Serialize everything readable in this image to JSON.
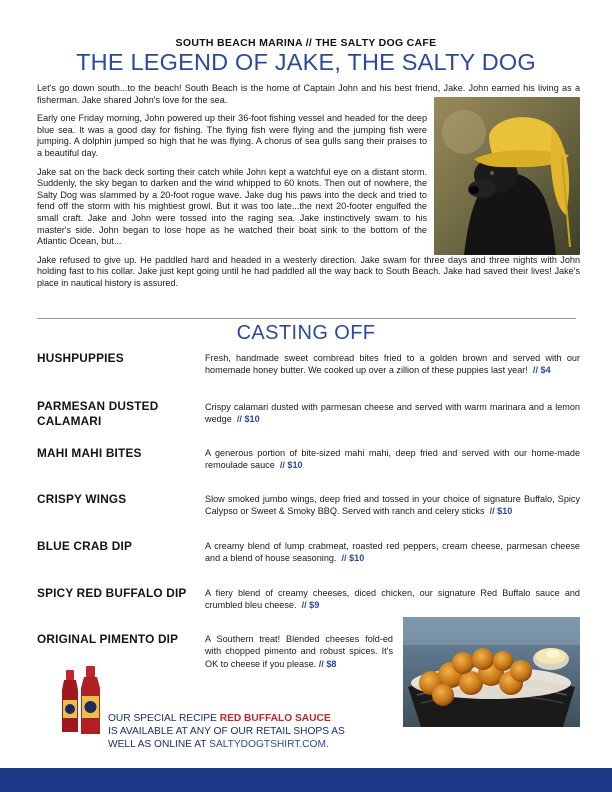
{
  "header": {
    "kicker": "SOUTH BEACH MARINA // THE SALTY DOG CAFE",
    "title": "THE LEGEND OF JAKE, THE SALTY DOG"
  },
  "story": {
    "p1": "Let's go down south...to the beach! South Beach is the home of Captain John and his best friend, Jake. John earned his living as a fisherman. Jake shared John's love for the sea.",
    "p2": "Early one Friday morning, John powered up their 36-foot fishing vessel and headed for the deep blue sea. It was a good day for fishing. The flying fish were flying and the jumping fish were jumping. A dolphin jumped so high that he was flying. A chorus of sea gulls sang their praises to a beautiful day.",
    "p3": "Jake sat on the back deck sorting their catch while John kept a watchful eye on a distant storm. Suddenly, the sky began to darken and the wind whipped to 60 knots. Then out of nowhere, the Salty Dog was slammed by a 20-foot rogue wave. Jake dug his paws into the deck and tried to fend off the storm with his mightiest growl. But it was too late...the next 20-footer engulfed the small craft. Jake and John were tossed into the raging sea. Jake instinctively swam to his master's side. John began to lose hope as he watched their boat sink to the bottom of the Atlantic Ocean, but...",
    "p4": "Jake refused to give up. He paddled hard and headed in a westerly direction. Jake swam for three days and three nights with John holding fast to his collar. Jake just kept going until he had paddled all the way back to South Beach. Jake had saved their lives! Jake's place in nautical history is assured."
  },
  "section": {
    "title": "CASTING OFF"
  },
  "menu": {
    "items": [
      {
        "name": "HUSHPUPPIES",
        "desc": "Fresh, handmade sweet cornbread bites fried to a golden brown and served with our homemade honey butter. We cooked up over a zillion of these puppies last year!",
        "price": "$4"
      },
      {
        "name": "PARMESAN DUSTED CALAMARI",
        "desc": "Crispy calamari dusted with parmesan cheese and served with warm marinara and a lemon wedge",
        "price": "$10"
      },
      {
        "name": "MAHI MAHI BITES",
        "desc": "A generous portion of bite-sized mahi mahi, deep fried and served with our home-made remoulade sauce",
        "price": "$10"
      },
      {
        "name": "CRISPY WINGS",
        "desc": "Slow smoked jumbo wings, deep fried and tossed in your choice of signature Buffalo, Spicy Calypso or Sweet & Smoky BBQ. Served with ranch and celery sticks",
        "price": "$10"
      },
      {
        "name": "BLUE CRAB DIP",
        "desc": "A creamy blend of lump crabmeat, roasted red peppers, cream cheese, parmesan cheese and a blend of house seasoning.",
        "price": "$10"
      },
      {
        "name": "SPICY RED BUFFALO DIP",
        "desc": "A fiery blend of creamy cheeses, diced chicken, our signature Red Buffalo sauce and crumbled bleu cheese.",
        "price": "$9"
      },
      {
        "name": "ORIGINAL PIMENTO DIP",
        "desc": "A Southern treat! Blended cheeses fold-ed with chopped pimento and robust spices. It's OK to cheese if you please.",
        "price": "$8"
      }
    ],
    "price_sep": "//"
  },
  "promo": {
    "line1_a": "OUR SPECIAL RECIPE ",
    "line1_hl": "RED BUFFALO SAUCE",
    "line2": "IS AVAILABLE AT ANY OF OUR RETAIL SHOPS AS",
    "line3_a": "WELL AS ONLINE AT ",
    "line3_link": "SALTYDOGTSHIRT.COM."
  },
  "colors": {
    "accent": "#2a4a9c",
    "highlight": "#c0262c",
    "footer": "#1c3a87"
  }
}
